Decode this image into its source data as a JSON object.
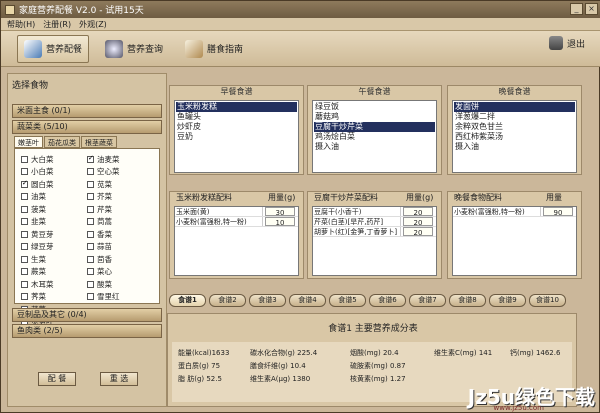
{
  "window": {
    "title": "家庭营养配餐 V2.0 - 试用15天"
  },
  "menu": [
    "帮助(H)",
    "注册(R)",
    "外观(Z)"
  ],
  "toolbar": {
    "buttons": [
      "营养配餐",
      "营养查询",
      "膳食指南"
    ],
    "exit": "退出"
  },
  "left": {
    "title": "选择食物",
    "categories": [
      "米面主食 (0/1)",
      "蔬菜类 (5/10)",
      "豆制品及其它 (0/4)",
      "鱼肉类 (2/5)"
    ],
    "subtabs": [
      "嫩茎叶",
      "茄花瓜类",
      "根茎蔬菜"
    ],
    "col1": [
      {
        "name": "大白菜",
        "c": false
      },
      {
        "name": "小白菜",
        "c": false
      },
      {
        "name": "圆白菜",
        "c": true
      },
      {
        "name": "油菜",
        "c": false
      },
      {
        "name": "菠菜",
        "c": false
      },
      {
        "name": "韭菜",
        "c": false
      },
      {
        "name": "黄豆芽",
        "c": false
      },
      {
        "name": "绿豆芽",
        "c": false
      },
      {
        "name": "生菜",
        "c": false
      },
      {
        "name": "蕨菜",
        "c": false
      },
      {
        "name": "木耳菜",
        "c": false
      },
      {
        "name": "荠菜",
        "c": false
      },
      {
        "name": "芹菜",
        "c": false
      },
      {
        "name": "苋笋叶",
        "c": false
      }
    ],
    "col2": [
      {
        "name": "油麦菜",
        "c": true
      },
      {
        "name": "空心菜",
        "c": false
      },
      {
        "name": "苋菜",
        "c": false
      },
      {
        "name": "芥菜",
        "c": false
      },
      {
        "name": "芹菜",
        "c": false
      },
      {
        "name": "茼蒿",
        "c": false
      },
      {
        "name": "香菜",
        "c": false
      },
      {
        "name": "蒜苗",
        "c": false
      },
      {
        "name": "茴香",
        "c": false
      },
      {
        "name": "菜心",
        "c": false
      },
      {
        "name": "酸菜",
        "c": false
      },
      {
        "name": "雪里红",
        "c": false
      }
    ],
    "buttons": [
      "配 餐",
      "重 选"
    ]
  },
  "meals": [
    {
      "title": "早餐食谱",
      "items": [
        "玉米粉发糕",
        "鱼罐头",
        "炒虾皮",
        "豆奶"
      ],
      "sel": 0,
      "recipe_title": "玉米粉发糕配料",
      "qty_label": "用量(g)",
      "rows": [
        [
          "玉米面(黄)",
          "30"
        ],
        [
          "小麦粉(富强粉,特一粉)",
          "10"
        ]
      ]
    },
    {
      "title": "午餐食谱",
      "items": [
        "绿豆饭",
        "蘑菇鸡",
        "豆腐干炒芹菜",
        "鸡汤烩白菜",
        "摄入油"
      ],
      "sel": 2,
      "recipe_title": "豆腐干炒芹菜配料",
      "qty_label": "用量(g)",
      "rows": [
        [
          "豆腐干(小香干)",
          "20"
        ],
        [
          "芹菜(白茎)[旱芹,药芹]",
          "20"
        ],
        [
          "胡萝卜(红)[金笋,丁香萝卜]",
          "20"
        ]
      ]
    },
    {
      "title": "晚餐食谱",
      "items": [
        "发面饼",
        "洋葱爆二拌",
        "余粹双色甘兰",
        "西红柿紫菜汤",
        "摄入油"
      ],
      "sel": 0,
      "recipe_title": "晚餐食物配料",
      "qty_label": "用量",
      "rows": [
        [
          "小麦粉(富强粉,特一粉)",
          "90"
        ]
      ]
    }
  ],
  "recipe_tabs": [
    "食谱1",
    "食谱2",
    "食谱3",
    "食谱4",
    "食谱5",
    "食谱6",
    "食谱7",
    "食谱8",
    "食谱9",
    "食谱10"
  ],
  "nutrition": {
    "title": "食谱1 主要营养成分表",
    "rows": [
      [
        "能量(kcal)1633",
        "碳水化合物(g) 225.4",
        "烟酸(mg) 20.4",
        "维生素C(mg) 141",
        "钙(mg) 1462.6"
      ],
      [
        "蛋白质(g) 75",
        "膳食纤维(g) 10.4",
        "硫胺素(mg) 0.87",
        "",
        ""
      ],
      [
        "脂 肪(g) 52.5",
        "维生素A(μg) 1380",
        "核黄素(mg) 1.27",
        "",
        ""
      ]
    ]
  },
  "watermark": {
    "logo": "Jz5u绿色下载",
    "url": "www.jz5u.com"
  }
}
